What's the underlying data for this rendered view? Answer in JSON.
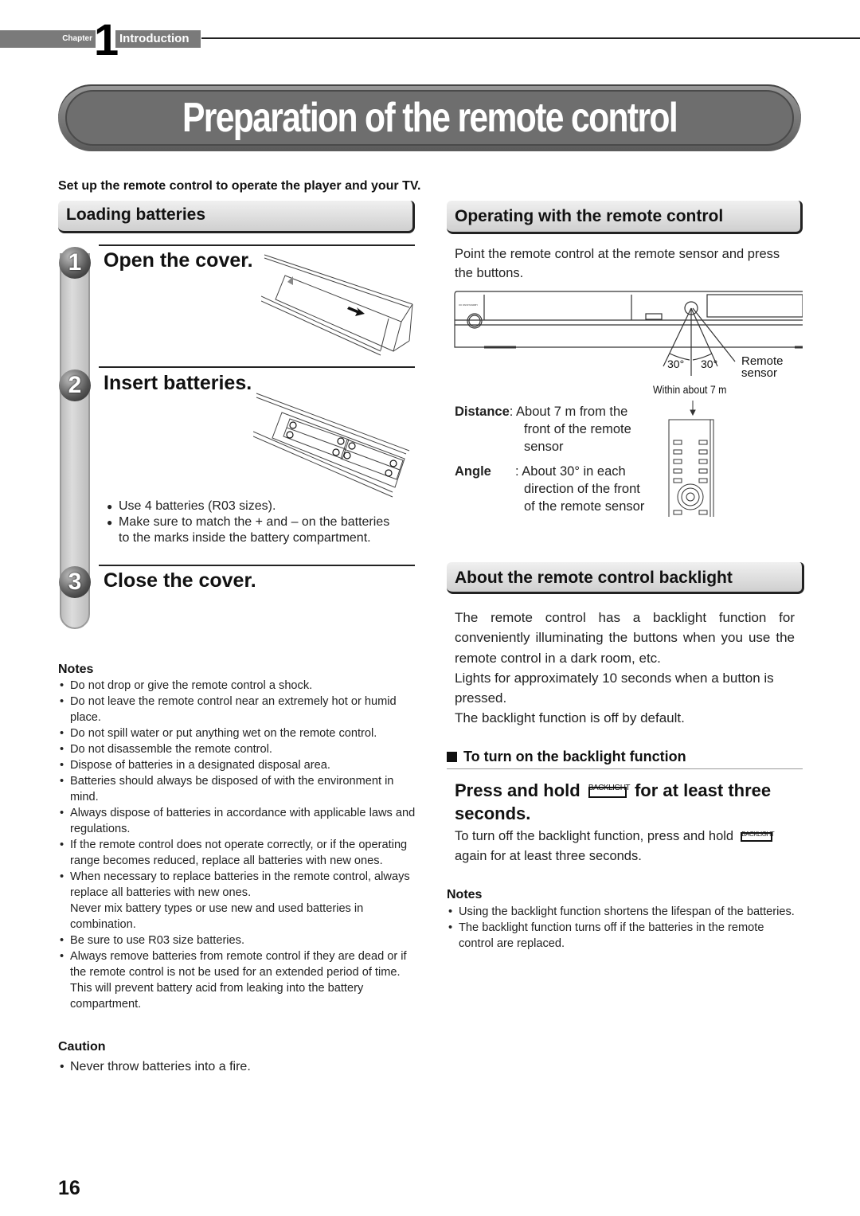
{
  "header": {
    "chapter_label": "Chapter",
    "chapter_number": "1",
    "chapter_title": "Introduction"
  },
  "page_title": "Preparation of the remote control",
  "intro": "Set up the remote control to operate the player and your TV.",
  "loading": {
    "heading": "Loading batteries",
    "steps": [
      {
        "number": "1",
        "title": "Open the cover."
      },
      {
        "number": "2",
        "title": "Insert batteries."
      },
      {
        "number": "3",
        "title": "Close the cover."
      }
    ],
    "step2_bullets": [
      "Use 4 batteries (R03 sizes).",
      "Make sure to match the + and – on the batteries to the marks inside the battery compartment."
    ]
  },
  "notes_left": {
    "title": "Notes",
    "items": [
      "Do not drop or give the remote control a shock.",
      "Do not leave the remote control near an extremely hot or humid place.",
      "Do not spill water or put anything wet on the remote control.",
      "Do not disassemble the remote control.",
      "Dispose of batteries in a designated disposal area.",
      "Batteries should always be disposed of with the environment in mind.",
      "Always dispose of batteries in accordance with applicable laws and regulations.",
      "If the remote control does not operate correctly, or if the operating range becomes reduced, replace all batteries with new ones.",
      "When necessary to replace batteries in the remote control, always replace all batteries with new ones.\nNever mix battery types or use new and used batteries in combination.",
      "Be sure to use R03 size batteries.",
      "Always remove batteries from remote control if they are dead or if the remote control is not be used for an extended period of time. This will prevent battery acid from leaking into the battery compartment."
    ]
  },
  "caution": {
    "title": "Caution",
    "items": [
      "Never throw batteries into a fire."
    ]
  },
  "operating": {
    "heading": "Operating with the remote control",
    "text": "Point the remote control at the remote sensor and press the buttons.",
    "diagram": {
      "angle_left": "30°",
      "angle_right": "30°",
      "sensor_label_1": "Remote",
      "sensor_label_2": "sensor",
      "range_label": "Within about 7 m"
    },
    "distance_label": "Distance",
    "distance_value": ": About 7 m from the",
    "distance_value_2": "front of the remote",
    "distance_value_3": "sensor",
    "angle_label": "Angle",
    "angle_value": ": About 30° in each",
    "angle_value_2": "direction of the front",
    "angle_value_3": "of the remote sensor"
  },
  "backlight": {
    "heading": "About the remote control backlight",
    "paragraph_1": "The remote control has a backlight function for conveniently illuminating the buttons when you use the remote control in a dark room, etc.",
    "paragraph_2": "Lights for approximately 10 seconds when a button is pressed.",
    "paragraph_3": "The backlight function is off by default.",
    "subheading": "To turn on the backlight function",
    "press_before": "Press and hold",
    "button_label": "BACKLIGHT",
    "press_after": "for at least three seconds.",
    "off_before": "To turn off the backlight function, press and hold",
    "off_after": "again for at least three seconds."
  },
  "notes_right": {
    "title": "Notes",
    "items": [
      "Using the backlight function shortens the lifespan of the batteries.",
      "The backlight function turns off if the batteries in the remote control are replaced."
    ]
  },
  "page_number": "16"
}
